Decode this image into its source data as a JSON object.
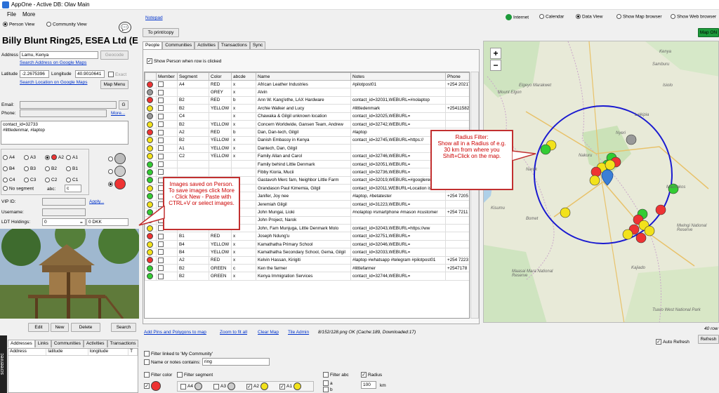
{
  "window": {
    "title": "AppOne - Active DB: Olav Main"
  },
  "menu": {
    "file": "File",
    "more": "More"
  },
  "view": {
    "person": "Person View",
    "community": "Community View",
    "notepad": "Notepad"
  },
  "contact": {
    "name": "Billy Blunt Ring25, ESEA Ltd (E",
    "address_label": "Address",
    "address": "Lamu, Kenya",
    "geocode": "Geocode",
    "search_address": "Search Address on Google Maps",
    "latitude_label": "Latitude",
    "latitude": "-2.2675396",
    "longitude_label": "Longitude",
    "longitude": "40.9010641",
    "exact": "Exact",
    "search_location": "Search Location on Google Maps",
    "map_menu": "Map Menu",
    "email_label": "Email:",
    "g": "G",
    "phone_label": "Phone:",
    "more": "More...",
    "notes": "contact_id=32733\n#littledenmar, #laptop",
    "vip_label": "VIP ID:",
    "apply": "Apply...",
    "username_label": "Username:",
    "ldt_label": "LDT Holdings:",
    "ldt_value": "0",
    "eq": "=",
    "dkk": "0 DKK"
  },
  "segments": {
    "row1": [
      "A4",
      "A3",
      "A2",
      "A1"
    ],
    "row2": [
      "B4",
      "B3",
      "B2",
      "B1"
    ],
    "row3": [
      "C4",
      "C3",
      "C2",
      "C1"
    ],
    "no_segment": "No segment",
    "abc_label": "abc:",
    "abc_value": "c"
  },
  "image_actions": {
    "edit": "Edit",
    "new": "New",
    "delete": "Delete",
    "search": "Search"
  },
  "bottom_tabs": [
    "Addresses",
    "Links",
    "Communities",
    "Activities",
    "Transactions"
  ],
  "bottom_cols": [
    "Address",
    "latitude",
    "longitude",
    "T"
  ],
  "side_badge": "screenrec",
  "center": {
    "print_copy": "To print/copy",
    "tabs": [
      "People",
      "Communities",
      "Activities",
      "Transactions",
      "Sync"
    ],
    "show_person": "Show Person when row is clicked",
    "columns": [
      "",
      "Member",
      "Segment",
      "Color",
      "abcde",
      "Name",
      "Notes",
      "Phone"
    ],
    "rows": [
      {
        "face": "#e33",
        "seg": "A4",
        "color": "RED",
        "abc": "x",
        "name": "African Leather Industries",
        "notes": "#pilotpost01",
        "phone": "+254 20217"
      },
      {
        "face": "#999",
        "seg": "",
        "color": "GREY",
        "abc": "x",
        "name": "Alvin",
        "notes": "",
        "phone": ""
      },
      {
        "face": "#e33",
        "seg": "B2",
        "color": "RED",
        "abc": "b",
        "name": "Ann W. Kang'ethe, LAX Hardware",
        "notes": "contact_id=32031,WEBURL=#nolaptop",
        "phone": ""
      },
      {
        "face": "#f2e21b",
        "seg": "B2",
        "color": "YELLOW",
        "abc": "x",
        "name": "Archie Walker and Lucy",
        "notes": "#littledenmark",
        "phone": "+25411582"
      },
      {
        "face": "#999",
        "seg": "C4",
        "color": "",
        "abc": "x",
        "name": "Chawaka & Gilgil unknown location",
        "notes": "contact_id=32025,WEBURL=",
        "phone": ""
      },
      {
        "face": "#f2e21b",
        "seg": "B2",
        "color": "YELLOW",
        "abc": "x",
        "name": "Concern Worldwide, Gansen Team, Andrew",
        "notes": "contact_id=32742,WEBURL=",
        "phone": ""
      },
      {
        "face": "#e33",
        "seg": "A2",
        "color": "RED",
        "abc": "b",
        "name": "Dan, Dan-tech, Gilgil",
        "notes": "#laptop",
        "phone": ""
      },
      {
        "face": "#f2e21b",
        "seg": "B2",
        "color": "YELLOW",
        "abc": "x",
        "name": "Danish Embassy in Kenya",
        "notes": "contact_id=32745,WEBURL=https://",
        "phone": ""
      },
      {
        "face": "#f2e21b",
        "seg": "A1",
        "color": "YELLOW",
        "abc": "x",
        "name": "Dantech, Dan, Gilgil",
        "notes": "",
        "phone": ""
      },
      {
        "face": "#f2e21b",
        "seg": "C2",
        "color": "YELLOW",
        "abc": "x",
        "name": "Family Allan and Carol",
        "notes": "contact_id=32746,WEBURL=",
        "phone": ""
      },
      {
        "face": "#3c3",
        "seg": "",
        "color": "",
        "abc": "",
        "name": "Family behind Little Denmark",
        "notes": "contact_id=32051,WEBURL=",
        "phone": ""
      },
      {
        "face": "#3c3",
        "seg": "",
        "color": "",
        "abc": "",
        "name": "Fibby Kioria, Mucii",
        "notes": "contact_id=32736,WEBURL=",
        "phone": ""
      },
      {
        "face": "#3c3",
        "seg": "",
        "color": "",
        "abc": "",
        "name": "Gastavoh Merc fam, Neighbor Little Farm",
        "notes": "contact_id=32019,WEBURL=#googlerem",
        "phone": "+254 7033"
      },
      {
        "face": "#f2e21b",
        "seg": "",
        "color": "",
        "abc": "",
        "name": "Grandason Paul Kimemia, Gilgil",
        "notes": "contact_id=32011,WEBURL=Location is",
        "phone": "+25476953"
      },
      {
        "face": "#3c3",
        "seg": "",
        "color": "",
        "abc": "",
        "name": "Janifer, Joy nee",
        "notes": "#laptop, #betatester",
        "phone": "+254 7205"
      },
      {
        "face": "#f2e21b",
        "seg": "",
        "color": "",
        "abc": "",
        "name": "Jeremiah Gilgil",
        "notes": "contact_id=31223,WEBURL=",
        "phone": ""
      },
      {
        "face": "#3c3",
        "seg": "B1",
        "color": "GREEN",
        "abc": "a",
        "name": "John Mungai, Lioki",
        "notes": "#nolaptop #smartphone #mason #customer",
        "phone": "+254 7211"
      },
      {
        "face": "#f2e21b",
        "seg": "A1",
        "color": "YELLOW",
        "abc": "x",
        "name": "John Project, Narok",
        "notes": "",
        "phone": ""
      },
      {
        "face": "#f2e21b",
        "seg": "B1",
        "color": "YELLOW",
        "abc": "a",
        "name": "John, Fam Munjuga, Little Denmark Molo",
        "notes": "contact_id=32043,WEBURL=https://ww",
        "phone": ""
      },
      {
        "face": "#e33",
        "seg": "B1",
        "color": "RED",
        "abc": "x",
        "name": "Joseph Ndung'u",
        "notes": "contact_id=32751,WEBURL=",
        "phone": ""
      },
      {
        "face": "#f2e21b",
        "seg": "B4",
        "color": "YELLOW",
        "abc": "x",
        "name": "Kamathatha Primary School",
        "notes": "contact_id=32046,WEBURL=",
        "phone": ""
      },
      {
        "face": "#f2e21b",
        "seg": "B4",
        "color": "YELLOW",
        "abc": "x",
        "name": "Kamathatha Secondary School, Gema, Gilgil",
        "notes": "contact_id=32033,WEBURL=",
        "phone": ""
      },
      {
        "face": "#e33",
        "seg": "A2",
        "color": "RED",
        "abc": "x",
        "name": "Kelvin Hassan, Kirigiti",
        "notes": "#laptop #whatsapp #telegram #pilotpost01",
        "phone": "+254 7223"
      },
      {
        "face": "#3c3",
        "seg": "B2",
        "color": "GREEN",
        "abc": "c",
        "name": "Ken the farmer",
        "notes": "#littlefarmer",
        "phone": "+2547178"
      },
      {
        "face": "#3c3",
        "seg": "B2",
        "color": "GREEN",
        "abc": "x",
        "name": "Kenya Immigration Services",
        "notes": "contact_id=32744,WEBURL=",
        "phone": ""
      }
    ],
    "status_links": [
      "Add Pins and Polygons to map",
      "Zoom to fit all",
      "Clear Map",
      "Tile Admin"
    ],
    "status_text": "8/152/128.png OK (Cache:189, Downloaded:17)"
  },
  "filters": {
    "linked": "Filter linked to 'My Community'",
    "name_notes": "Name or notes contains:",
    "name_notes_value": "ring",
    "color": "Filter color",
    "segment": "Filter segment",
    "seg_items": [
      "A4",
      "A3",
      "A2",
      "A1"
    ],
    "abc": "Filter abc",
    "abc_items": [
      "a",
      "b"
    ],
    "radius": "Radius",
    "radius_value": "100",
    "km": "km"
  },
  "right": {
    "internet": "Internet",
    "calendar": "Calendar",
    "data_view": "Data View",
    "show_map": "Show Map browser",
    "show_web": "Show Web browser",
    "map_on": "Map ON",
    "zoom_in": "+",
    "zoom_out": "−",
    "rows_count": "40 row",
    "auto_refresh": "Auto Refresh",
    "refresh": "Refresh"
  },
  "map_labels": [
    "Kenya",
    "Mount Elgon",
    "Elgeyo Marakwet",
    "Laikipia",
    "Nakuru",
    "Narok",
    "Kisumu",
    "Bomet",
    "Kajiado",
    "Machakos",
    "Nyeri",
    "Samburu",
    "Isiolo",
    "Tsavo West National Park",
    "Maasai Mara National Reserve",
    "Mwingi National Reserve"
  ],
  "callouts": {
    "radius": "Radius Filter:\nShow all in a Radius of e.g. 30 km from where you Shift+Click on the map.",
    "images": "Images saved on Person.\nTo save images click More - Click New - Paste with CTRL+V or select images."
  },
  "colors": {
    "red": "#e33",
    "yellow": "#f2e21b",
    "green": "#3c3",
    "grey": "#999",
    "map_green": "#1c9a3a",
    "radius_circle": "#1a1ad0"
  }
}
